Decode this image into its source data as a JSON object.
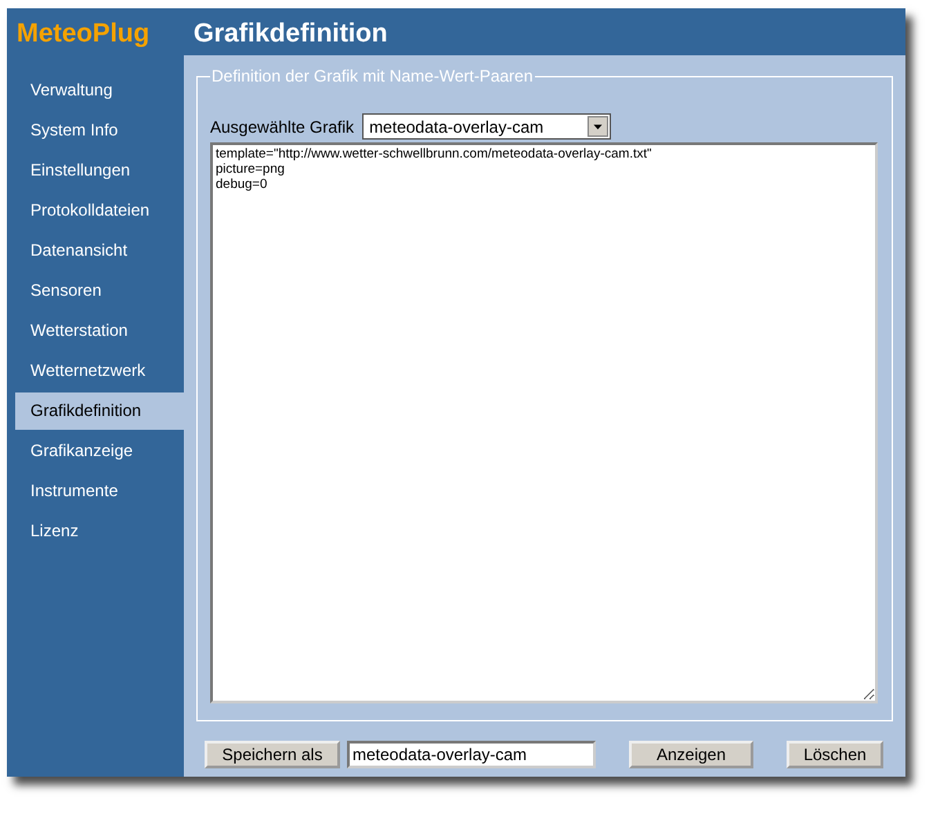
{
  "brand": "MeteoPlug",
  "title": "Grafikdefinition",
  "sidebar": {
    "items": [
      {
        "label": "Verwaltung",
        "selected": false
      },
      {
        "label": "System Info",
        "selected": false
      },
      {
        "label": "Einstellungen",
        "selected": false
      },
      {
        "label": "Protokolldateien",
        "selected": false
      },
      {
        "label": "Datenansicht",
        "selected": false
      },
      {
        "label": "Sensoren",
        "selected": false
      },
      {
        "label": "Wetterstation",
        "selected": false
      },
      {
        "label": "Wetternetzwerk",
        "selected": false
      },
      {
        "label": "Grafikdefinition",
        "selected": true
      },
      {
        "label": "Grafikanzeige",
        "selected": false
      },
      {
        "label": "Instrumente",
        "selected": false
      },
      {
        "label": "Lizenz",
        "selected": false
      }
    ]
  },
  "fieldset": {
    "legend": "Definition der Grafik mit Name-Wert-Paaren",
    "select_label": "Ausgewählte Grafik",
    "select_value": "meteodata-overlay-cam",
    "editor_value": "template=\"http://www.wetter-schwellbrunn.com/meteodata-overlay-cam.txt\"\npicture=png\ndebug=0"
  },
  "footer": {
    "save_button": "Speichern als",
    "name_value": "meteodata-overlay-cam",
    "show_button": "Anzeigen",
    "delete_button": "Löschen"
  }
}
